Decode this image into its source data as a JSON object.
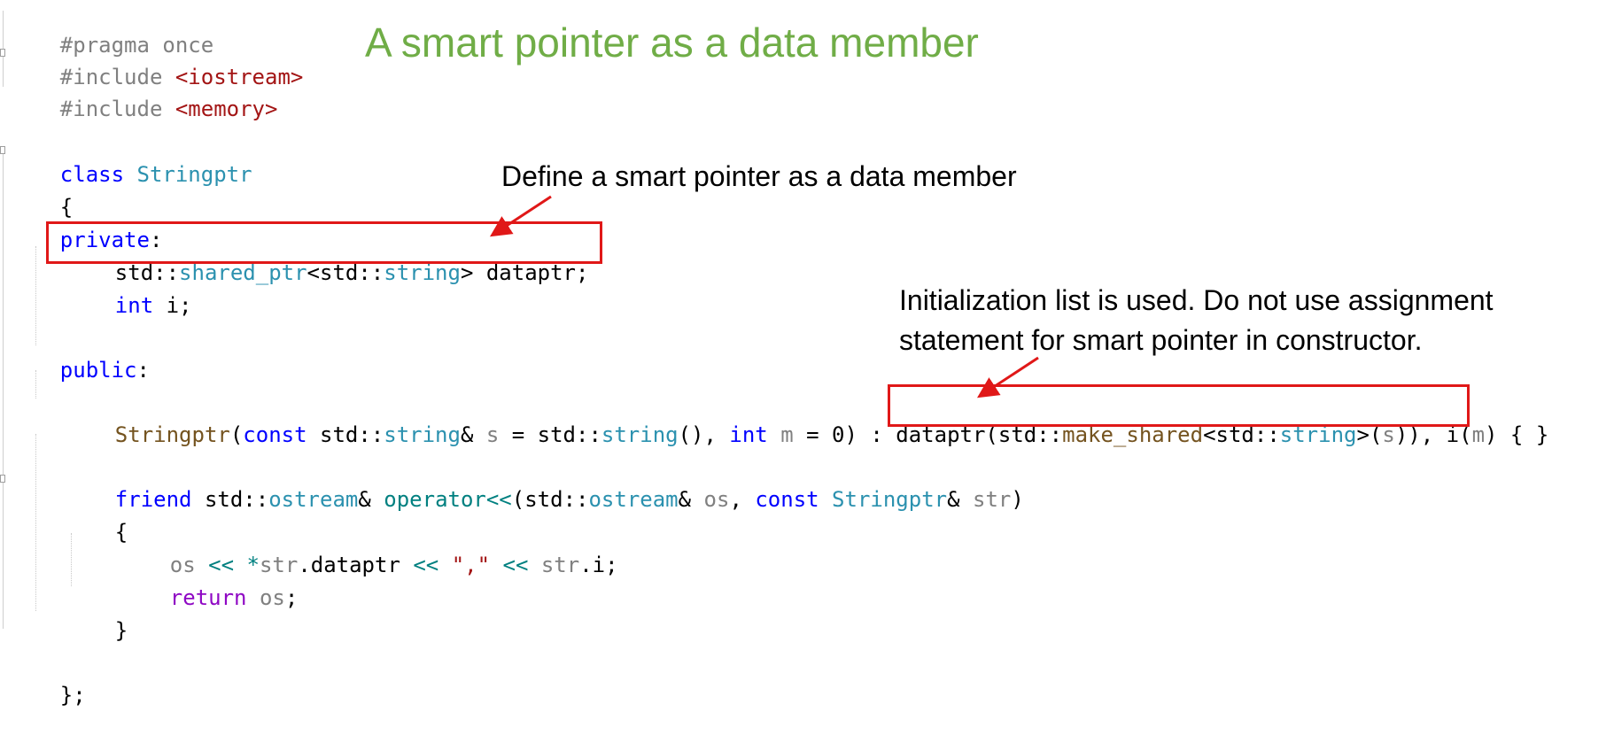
{
  "slide": {
    "title": "A smart pointer as a data member",
    "colors": {
      "title": "#70ad47",
      "highlight_box": "#e01818",
      "keyword": "#0000ff",
      "control_keyword": "#8f08c4",
      "type": "#2b91af",
      "string": "#a31515",
      "preprocessor": "#808080",
      "parameter": "#808080",
      "function": "#74531f"
    },
    "annotations": {
      "data_member": "Define a smart pointer as a data member",
      "init_list_line1": "Initialization list is used. Do not use assignment",
      "init_list_line2": "statement for smart pointer in constructor."
    }
  },
  "code": {
    "l1_directive": "#pragma once",
    "l2_directive": "#include ",
    "l2_header": "<iostream>",
    "l3_directive": "#include ",
    "l3_header": "<memory>",
    "l5_kw": "class",
    "l5_name": "Stringptr",
    "l6": "{",
    "l7_kw": "private",
    "l7_colon": ":",
    "l8_ns1": "std::",
    "l8_type1": "shared_ptr",
    "l8_lt": "<",
    "l8_ns2": "std::",
    "l8_type2": "string",
    "l8_gt": ">",
    "l8_rest": " dataptr;",
    "l9_kw": "int",
    "l9_rest": " i;",
    "l11_kw": "public",
    "l11_colon": ":",
    "l13_fn": "Stringptr",
    "l13_p1": "(",
    "l13_kw_const": "const",
    "l13_ns1": " std::",
    "l13_type1": "string",
    "l13_amp": "& ",
    "l13_prm_s": "s",
    "l13_eq1": " = std::",
    "l13_type2": "string",
    "l13_call": "(), ",
    "l13_kw_int": "int",
    "l13_sp": " ",
    "l13_prm_m": "m",
    "l13_eq2": " = 0) : ",
    "l13_init_member": "dataptr",
    "l13_init_p": "(",
    "l13_ns3": "std::",
    "l13_fn_make": "make_shared",
    "l13_lt": "<",
    "l13_ns4": "std::",
    "l13_type3": "string",
    "l13_gt": ">",
    "l13_p2": "(",
    "l13_prm_s2": "s",
    "l13_close": ")),",
    "l13_i": " i(",
    "l13_prm_m2": "m",
    "l13_end": ") { }",
    "l15_kw": "friend",
    "l15_ns1": " std::",
    "l15_type1": "ostream",
    "l15_amp1": "& ",
    "l15_fn": "operator<<",
    "l15_p": "(std::",
    "l15_type2": "ostream",
    "l15_amp2": "& ",
    "l15_prm_os": "os",
    "l15_comma": ", ",
    "l15_kw_const": "const",
    "l15_sp": " ",
    "l15_type3": "Stringptr",
    "l15_amp3": "& ",
    "l15_prm_str": "str",
    "l15_end": ")",
    "l16": "{",
    "l17_prm_os": "os",
    "l17_op1": " << ",
    "l17_star": "*",
    "l17_prm_str": "str",
    "l17_member": ".dataptr",
    "l17_op2": " << ",
    "l17_str": "\",\"",
    "l17_op3": " << ",
    "l17_prm_str2": "str",
    "l17_end": ".i;",
    "l18_kw": "return",
    "l18_sp": " ",
    "l18_prm_os": "os",
    "l18_end": ";",
    "l19": "}",
    "l21": "};"
  }
}
